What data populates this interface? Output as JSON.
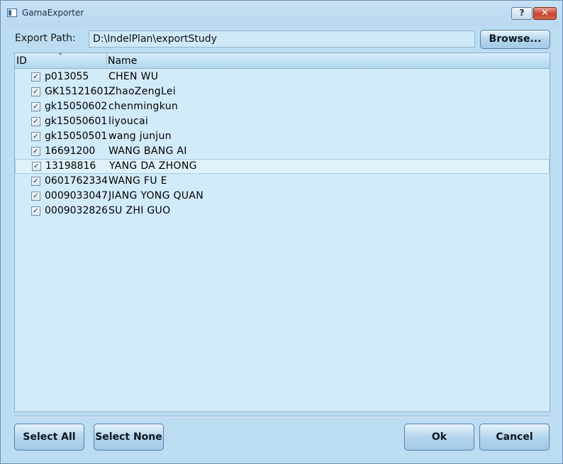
{
  "window": {
    "title": "GamaExporter",
    "help_label": "?",
    "close_label": "✕"
  },
  "export": {
    "label": "Export Path:",
    "path_value": "D:\\IndelPlan\\exportStudy",
    "browse_label": "Browse..."
  },
  "list": {
    "columns": {
      "id": "ID",
      "name": "Name"
    },
    "check_glyph": "✓",
    "selected_row_index": 6,
    "rows": [
      {
        "id": "p013055",
        "name": "CHEN WU",
        "checked": true
      },
      {
        "id": "GK15121601",
        "name": "ZhaoZengLei",
        "checked": true
      },
      {
        "id": "gk15050602",
        "name": "chenmingkun",
        "checked": true
      },
      {
        "id": "gk15050601",
        "name": "liyoucai",
        "checked": true
      },
      {
        "id": "gk15050501",
        "name": "wang junjun",
        "checked": true
      },
      {
        "id": "16691200",
        "name": "WANG BANG AI",
        "checked": true
      },
      {
        "id": "13198816",
        "name": "YANG DA ZHONG",
        "checked": true
      },
      {
        "id": "0601762334",
        "name": "WANG FU E",
        "checked": true
      },
      {
        "id": "0009033047",
        "name": "JIANG YONG QUAN",
        "checked": true
      },
      {
        "id": "0009032826",
        "name": "SU ZHI GUO",
        "checked": true
      }
    ]
  },
  "footer": {
    "select_all_label": "Select All",
    "select_none_label": "Select None",
    "ok_label": "Ok",
    "cancel_label": "Cancel"
  },
  "colors": {
    "window_bg": "#bcdcf2",
    "list_bg": "#d2ebf9",
    "close_button": "#c8412c"
  }
}
